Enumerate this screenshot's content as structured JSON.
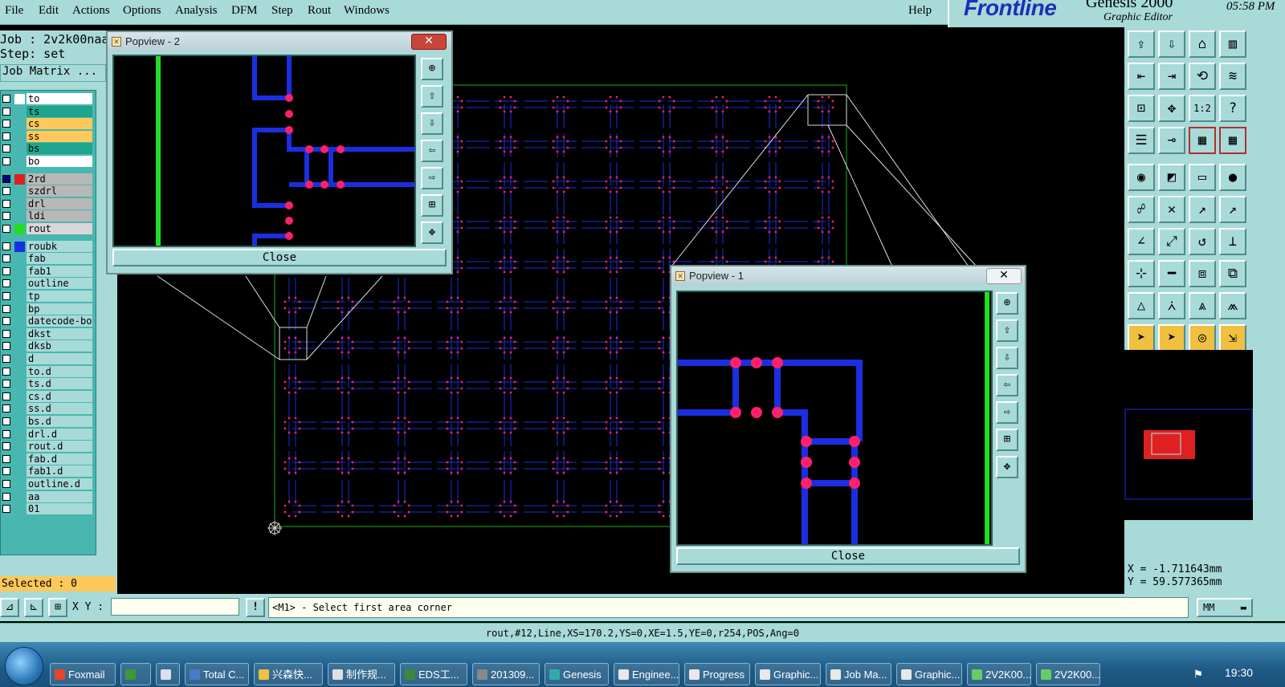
{
  "menu": [
    "File",
    "Edit",
    "Actions",
    "Options",
    "Analysis",
    "DFM",
    "Step",
    "Rout",
    "Windows"
  ],
  "help": "Help",
  "brand": {
    "logo": "Frontline",
    "product": "Genesis 2000",
    "subtitle": "Graphic Editor",
    "time": "05:58 PM"
  },
  "job": {
    "line": "Job : 2v2k00naa",
    "step": "Step: set",
    "matrix": "Job Matrix ..."
  },
  "layers": [
    {
      "name": "to",
      "color": "#ffffff",
      "bg": "#ffffff"
    },
    {
      "name": "ts",
      "color": "",
      "bg": "#1fa58e"
    },
    {
      "name": "cs",
      "color": "",
      "bg": "#ffc85a"
    },
    {
      "name": "ss",
      "color": "",
      "bg": "#ffc85a"
    },
    {
      "name": "bs",
      "color": "",
      "bg": "#1fa58e"
    },
    {
      "name": "bo",
      "color": "",
      "bg": "#ffffff"
    },
    {
      "name": "2rd",
      "color": "#e02020",
      "bg": "#b8b8b8"
    },
    {
      "name": "szdrl",
      "color": "",
      "bg": "#b8b8b8"
    },
    {
      "name": "drl",
      "color": "",
      "bg": "#b8b8b8"
    },
    {
      "name": "ldi",
      "color": "",
      "bg": "#b8b8b8"
    },
    {
      "name": "rout",
      "color": "#22dd22",
      "bg": "#d8d8d8"
    },
    {
      "name": "roubk",
      "color": "#1a2fe0",
      "bg": "#a8dad8"
    },
    {
      "name": "fab",
      "color": "",
      "bg": "#a8dad8"
    },
    {
      "name": "fab1",
      "color": "",
      "bg": "#a8dad8"
    },
    {
      "name": "outline",
      "color": "",
      "bg": "#a8dad8"
    },
    {
      "name": "tp",
      "color": "",
      "bg": "#a8dad8"
    },
    {
      "name": "bp",
      "color": "",
      "bg": "#a8dad8"
    },
    {
      "name": "datecode-bo",
      "color": "",
      "bg": "#a8dad8"
    },
    {
      "name": "dkst",
      "color": "",
      "bg": "#a8dad8"
    },
    {
      "name": "dksb",
      "color": "",
      "bg": "#a8dad8"
    },
    {
      "name": "d",
      "color": "",
      "bg": "#a8dad8"
    },
    {
      "name": "to.d",
      "color": "",
      "bg": "#a8dad8"
    },
    {
      "name": "ts.d",
      "color": "",
      "bg": "#a8dad8"
    },
    {
      "name": "cs.d",
      "color": "",
      "bg": "#a8dad8"
    },
    {
      "name": "ss.d",
      "color": "",
      "bg": "#a8dad8"
    },
    {
      "name": "bs.d",
      "color": "",
      "bg": "#a8dad8"
    },
    {
      "name": "drl.d",
      "color": "",
      "bg": "#a8dad8"
    },
    {
      "name": "rout.d",
      "color": "",
      "bg": "#a8dad8"
    },
    {
      "name": "fab.d",
      "color": "",
      "bg": "#a8dad8"
    },
    {
      "name": "fab1.d",
      "color": "",
      "bg": "#a8dad8"
    },
    {
      "name": "outline.d",
      "color": "",
      "bg": "#a8dad8"
    },
    {
      "name": "aa",
      "color": "",
      "bg": "#a8dad8"
    },
    {
      "name": "01",
      "color": "",
      "bg": "#a8dad8"
    }
  ],
  "selected": "Selected : 0",
  "popview2": {
    "title": "Popview - 2",
    "close": "Close"
  },
  "popview1": {
    "title": "Popview - 1",
    "close": "Close"
  },
  "coords": {
    "x": "X = -1.711643mm",
    "y": "Y = 59.577365mm"
  },
  "cmd": {
    "xy_label": "X Y :",
    "xy_value": "",
    "prompt": "<M1> - Select first area corner",
    "units": "MM"
  },
  "status": "rout,#12,Line,XS=170.2,YS=0,XE=1.5,YE=0,r254,POS,Ang=0",
  "taskbar": {
    "items": [
      "Foxmail",
      "",
      "",
      "Total C...",
      "兴森快...",
      "制作规...",
      "EDS工...",
      "201309...",
      "Genesis",
      "Enginee...",
      "Progress",
      "Graphic...",
      "Job Ma...",
      "Graphic...",
      "2V2K00...",
      "2V2K00..."
    ],
    "clock": "19:30"
  },
  "colors": {
    "panel": "#a8dad8",
    "trace": "#1a2fe0",
    "pad": "#ff1f6e",
    "outline": "#22dd22"
  }
}
